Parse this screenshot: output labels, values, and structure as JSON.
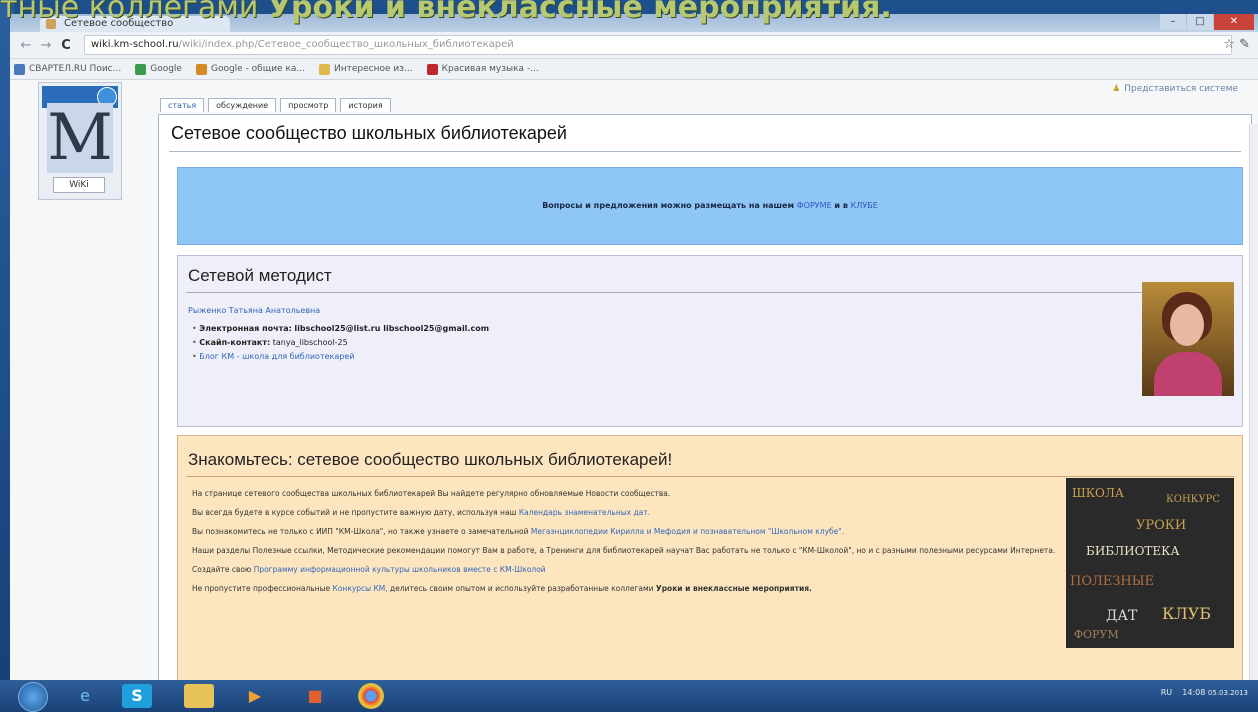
{
  "slide": {
    "title_prefix": "тные коллегами ",
    "title_bold": "Уроки и внеклассные мероприятия."
  },
  "browser": {
    "tab_title": "Сетевое сообщество",
    "window_controls": [
      "–",
      "□",
      "✕"
    ],
    "back": "←",
    "forward": "→",
    "reload": "C",
    "url_host": "wiki.km-school.ru",
    "url_path": "/wiki/index.php/Сетевое_сообщество_школьных_библиотекарей",
    "star": "☆",
    "wrench": "✎",
    "bookmarks": [
      "СВАРТЕЛ.RU Поис...",
      "Google",
      "Google - общие ка...",
      "Интересное из...",
      "Красивая музыка -..."
    ]
  },
  "page": {
    "logo_wiki": "WiKi",
    "user_link": "Представиться системе",
    "tabs": [
      "статья",
      "обсуждение",
      "просмотр",
      "история"
    ],
    "heading": "Сетевое сообщество школьных библиотекарей",
    "notice_text": "Вопросы и предложения можно размещать на нашем",
    "notice_forum": "ФОРУМЕ",
    "notice_and": "и в",
    "notice_club": "КЛУБЕ",
    "methodist": {
      "title": "Сетевой методист",
      "name": "Рыженко Татьяна Анатольевна",
      "email_label": "Электронная почта:",
      "email_value": "libschool25@list.ru   libschool25@gmail.com",
      "skype_label": "Скайп-контакт:",
      "skype_value": "tanya_libschool-25",
      "blog_link": "Блог КМ - школа для библиотекарей"
    },
    "community": {
      "title": "Знакомьтесь: сетевое сообщество школьных библиотекарей!",
      "p1": "На странице сетевого сообщества школьных библиотекарей Вы найдете регулярно обновляемые Новости сообщества.",
      "p2_text": "Вы всегда будете в курсе событий и не пропустите важную дату, используя наш",
      "p2_link": "Календарь знаменательных дат.",
      "p3_text": "Вы познакомитесь не только с ИИП \"КМ-Школа\", но также узнаете о замечательной",
      "p3_link": "Мегаэнциклопедии Кирилла и Мефодия и познавательном \"Школьном клубе\".",
      "p4": "Наши разделы Полезные ссылки, Методические рекомендации помогут Вам в работе, а Тренинги для библиотекарей научат Вас работать не только с \"КМ-Школой\", но и с разными полезными ресурсами Интернета.",
      "p5_text": "Создайте свою",
      "p5_link": "Программу информационной культуры школьников вместе с КМ-Школой",
      "p6_text": "Не пропустите профессиональные",
      "p6_link": "Конкурсы КМ,",
      "p6_tail": "делитесь своим опытом и используйте разработанные коллегами",
      "p6_bold": "Уроки и внеклассные мероприятия."
    },
    "wordcloud_words": [
      "ШКОЛА",
      "КЛУБ",
      "ДАТ",
      "УРОКИ",
      "ПОЛЕЗНЫЕ",
      "БИБЛИОТЕКА",
      "КОНКУРС",
      "ФОРУМ"
    ]
  },
  "taskbar": {
    "icons": [
      "ie-icon",
      "skype-icon",
      "folder-icon",
      "media-icon",
      "app-icon",
      "chrome-icon"
    ],
    "lang": "RU",
    "time": "14:08",
    "date": "05.03.2013"
  }
}
